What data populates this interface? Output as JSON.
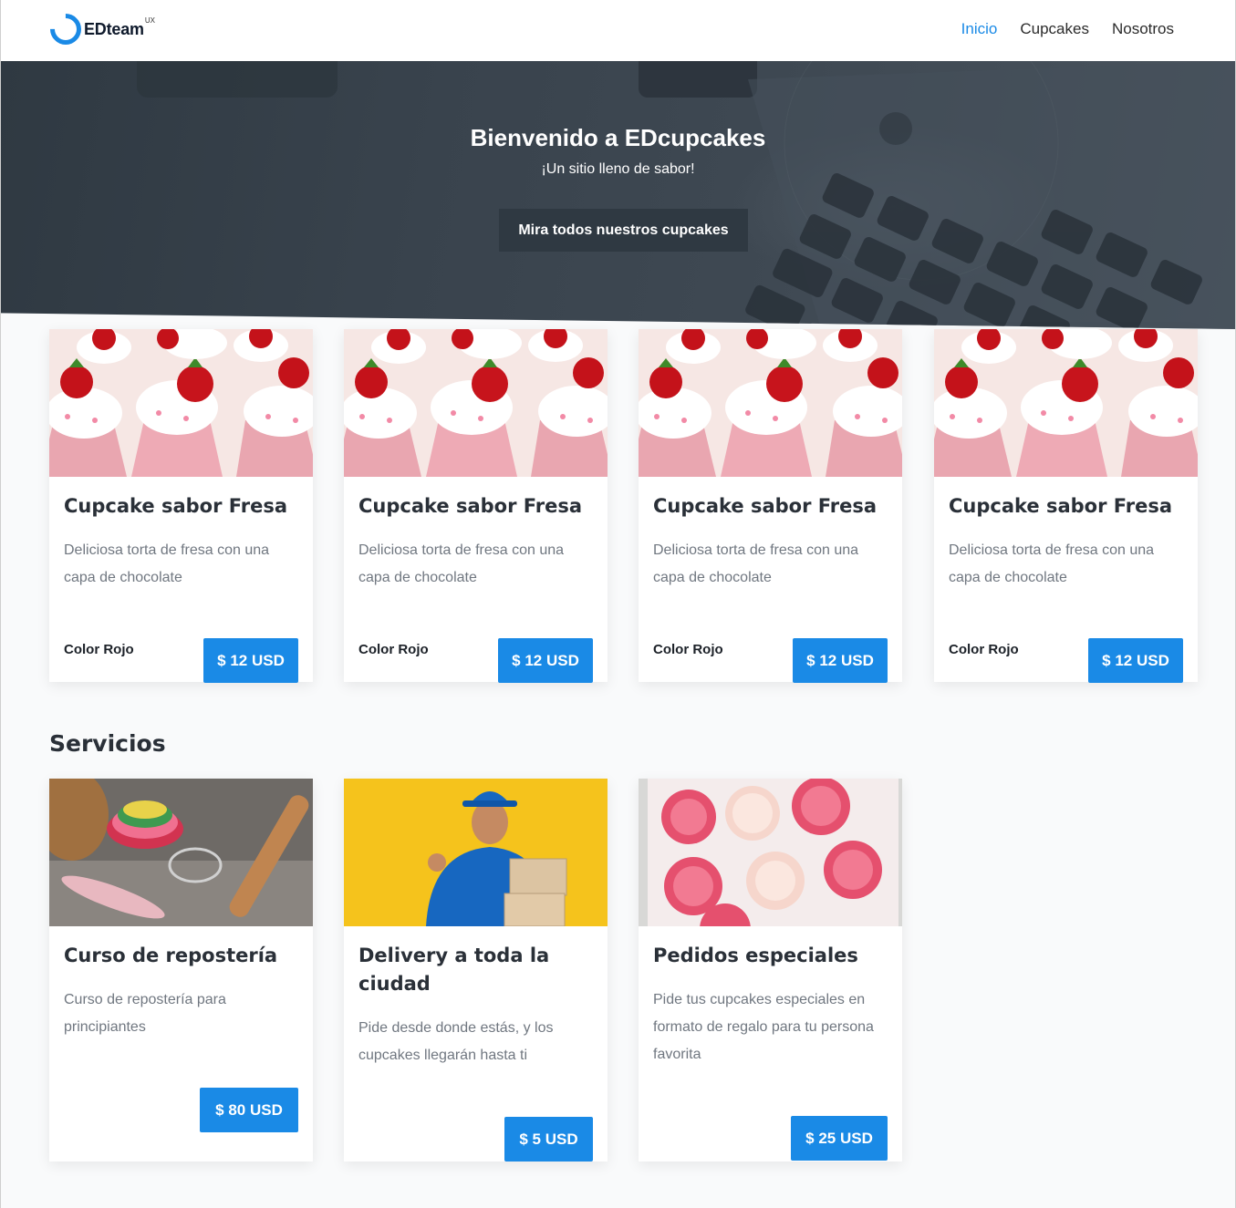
{
  "header": {
    "logo_text": "EDteam",
    "logo_sup": "UX",
    "nav": [
      {
        "label": "Inicio",
        "active": true
      },
      {
        "label": "Cupcakes",
        "active": false
      },
      {
        "label": "Nosotros",
        "active": false
      }
    ]
  },
  "hero": {
    "title": "Bienvenido a EDcupcakes",
    "subtitle": "¡Un sitio lleno de sabor!",
    "cta_label": "Mira todos nuestros cupcakes"
  },
  "products": [
    {
      "title": "Cupcake sabor Fresa",
      "description": "Deliciosa torta de fresa con una capa de chocolate",
      "color_label": "Color Rojo",
      "price": "$ 12 USD"
    },
    {
      "title": "Cupcake sabor Fresa",
      "description": "Deliciosa torta de fresa con una capa de chocolate",
      "color_label": "Color Rojo",
      "price": "$ 12 USD"
    },
    {
      "title": "Cupcake sabor Fresa",
      "description": "Deliciosa torta de fresa con una capa de chocolate",
      "color_label": "Color Rojo",
      "price": "$ 12 USD"
    },
    {
      "title": "Cupcake sabor Fresa",
      "description": "Deliciosa torta de fresa con una capa de chocolate",
      "color_label": "Color Rojo",
      "price": "$ 12 USD"
    }
  ],
  "services_title": "Servicios",
  "services": [
    {
      "title": "Curso de repostería",
      "description": "Curso de repostería para principiantes",
      "price": "$ 80 USD"
    },
    {
      "title": "Delivery a toda la ciudad",
      "description": "Pide desde donde estás, y los cupcakes llegarán hasta ti",
      "price": "$ 5 USD"
    },
    {
      "title": "Pedidos especiales",
      "description": "Pide tus cupcakes especiales en formato de regalo para tu persona favorita",
      "price": "$ 25 USD"
    }
  ],
  "colors": {
    "accent": "#1a8ae6",
    "hero_dark": "#2f3942",
    "heading": "#2a3038",
    "muted": "#707780"
  }
}
